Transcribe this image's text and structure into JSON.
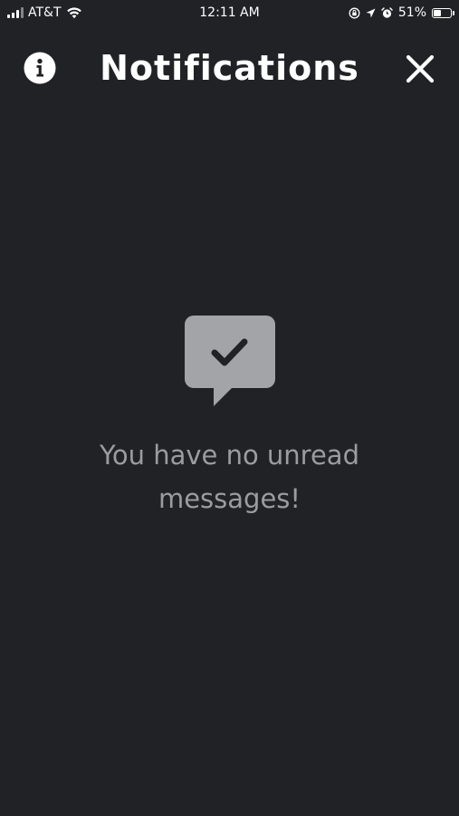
{
  "status_bar": {
    "carrier": "AT&T",
    "time": "12:11 AM",
    "battery_percent": "51%",
    "battery_level": 0.51,
    "icons": [
      "signal-icon",
      "wifi-icon",
      "screen-rotation-lock-icon",
      "location-arrow-icon",
      "alarm-icon",
      "battery-icon"
    ]
  },
  "header": {
    "title": "Notifications",
    "left_icon": "info-icon",
    "right_icon": "close-icon"
  },
  "empty_state": {
    "icon": "chat-check-icon",
    "message": "You have no unread messages!"
  },
  "colors": {
    "background": "#212225",
    "title": "#ffffff",
    "empty_icon": "#a3a4a7",
    "empty_text": "#9b9ca0"
  }
}
